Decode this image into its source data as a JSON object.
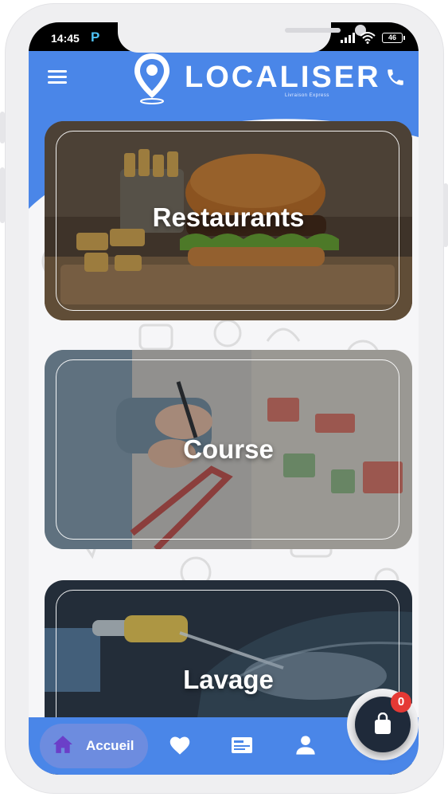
{
  "status_bar": {
    "time": "14:45",
    "app_indicator": "P",
    "battery": "46"
  },
  "header": {
    "logo_text": "LOCALISER",
    "logo_subtitle": "Livraison Express",
    "menu_icon": "hamburger-menu-icon",
    "call_icon": "phone-icon",
    "brand_color": "#4a86e8"
  },
  "categories": [
    {
      "label": "Restaurants",
      "image": "burger-and-fries-photo"
    },
    {
      "label": "Course",
      "image": "supermarket-shopping-photo"
    },
    {
      "label": "Lavage",
      "image": "car-wash-photo"
    }
  ],
  "bottom_nav": {
    "items": [
      {
        "label": "Accueil",
        "icon": "home-icon",
        "active": true
      },
      {
        "label": "",
        "icon": "heart-icon",
        "active": false
      },
      {
        "label": "",
        "icon": "card-icon",
        "active": false
      },
      {
        "label": "",
        "icon": "person-icon",
        "active": false
      }
    ]
  },
  "cart": {
    "icon": "shopping-bag-icon",
    "count": "0"
  }
}
